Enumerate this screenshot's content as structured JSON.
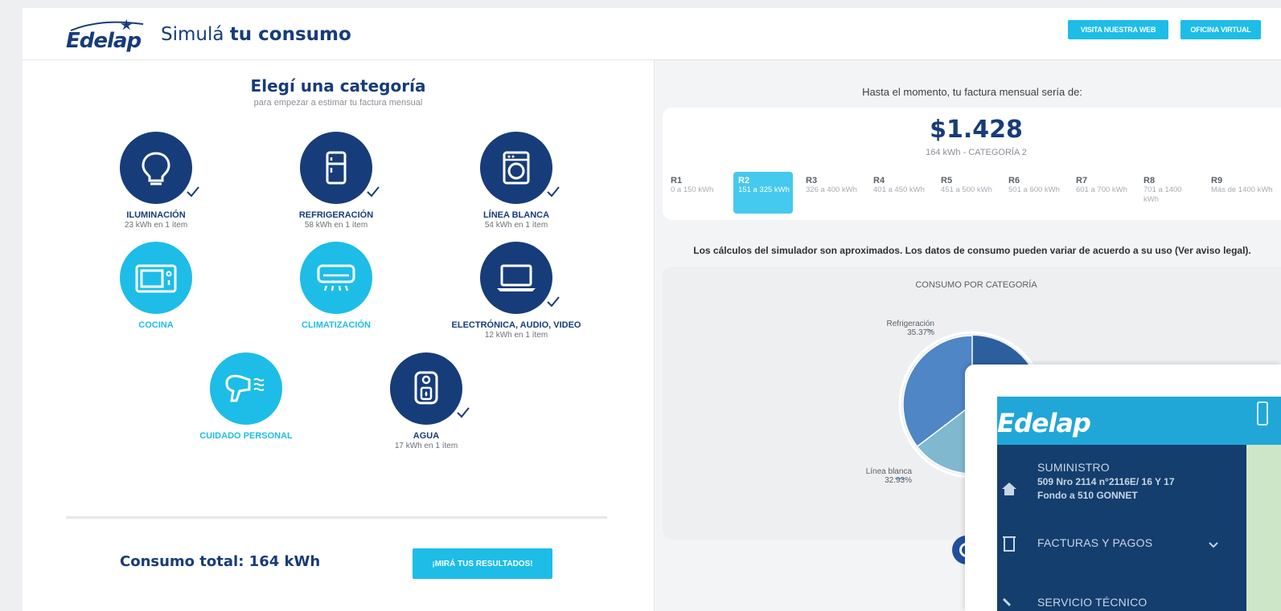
{
  "header": {
    "logo": "Edelap",
    "title_light": "Simulá",
    "title_bold": "tu consumo",
    "visit_web_label": "VISITA NUESTRA WEB",
    "virtual_office_label": "OFICINA VIRTUAL"
  },
  "left": {
    "title": "Elegí una categoría",
    "subtitle": "para empezar a estimar tu factura mensual",
    "categories": [
      {
        "name": "ILUMINACIÓN",
        "detail": "23 kWh en 1 ítem",
        "icon": "lightbulb-icon",
        "selected": true
      },
      {
        "name": "REFRIGERACIÓN",
        "detail": "58 kWh en 1 ítem",
        "icon": "fridge-icon",
        "selected": true
      },
      {
        "name": "LÍNEA BLANCA",
        "detail": "54 kWh en 1 ítem",
        "icon": "washing-machine-icon",
        "selected": true
      },
      {
        "name": "COCINA",
        "detail": "",
        "icon": "microwave-icon",
        "selected": false
      },
      {
        "name": "CLIMATIZACIÓN",
        "detail": "",
        "icon": "air-conditioner-icon",
        "selected": false
      },
      {
        "name": "ELECTRÓNICA, AUDIO, VIDEO",
        "detail": "12 kWh en 1 ítem",
        "icon": "laptop-icon",
        "selected": true
      },
      {
        "name": "CUIDADO PERSONAL",
        "detail": "",
        "icon": "hair-dryer-icon",
        "selected": false
      },
      {
        "name": "AGUA",
        "detail": "17 kWh en 1 ítem",
        "icon": "water-heater-icon",
        "selected": true
      }
    ],
    "total_label": "Consumo total: 164 kWh",
    "results_button": "¡MIRÁ TUS RESULTADOS!"
  },
  "right": {
    "so_far": "Hasta el momento, tu factura mensual sería de:",
    "amount": "$1.428",
    "amount_sub": "164 kWh - CATEGORÍA 2",
    "ranges": [
      {
        "name": "R1",
        "range": "0 a 150 kWh",
        "active": false
      },
      {
        "name": "R2",
        "range": "151 a 325 kWh",
        "active": true
      },
      {
        "name": "R3",
        "range": "326 a 400 kWh",
        "active": false
      },
      {
        "name": "R4",
        "range": "401 a 450 kWh",
        "active": false
      },
      {
        "name": "R5",
        "range": "451 a 500 kWh",
        "active": false
      },
      {
        "name": "R6",
        "range": "501 a 600 kWh",
        "active": false
      },
      {
        "name": "R7",
        "range": "601 a 700 kWh",
        "active": false
      },
      {
        "name": "R8",
        "range": "701 a 1400 kWh",
        "active": false
      },
      {
        "name": "R9",
        "range": "Más de 1400 kWh",
        "active": false
      }
    ],
    "disclaimer": "Los cálculos del simulador son aproximados. Los datos de consumo pueden variar de acuerdo a su uso (Ver aviso legal).",
    "chart_title": "CONSUMO POR CATEGORÍA"
  },
  "chart_data": {
    "type": "pie",
    "title": "CONSUMO POR CATEGORÍA",
    "labels": [
      "Refrigeración",
      "Línea blanca"
    ],
    "values": [
      35.37,
      32.93
    ],
    "colors": [
      "#4e86c6",
      "#7fb8cf"
    ]
  },
  "overlay": {
    "logo": "Edelap",
    "supply_label": "SUMINISTRO",
    "supply_address_1": "509 Nro 2114 n°2116E/ 16 Y 17",
    "supply_address_2": "Fondo a 510 GONNET",
    "bills_label": "FACTURAS Y PAGOS",
    "tech_label": "SERVICIO TÉCNICO"
  }
}
